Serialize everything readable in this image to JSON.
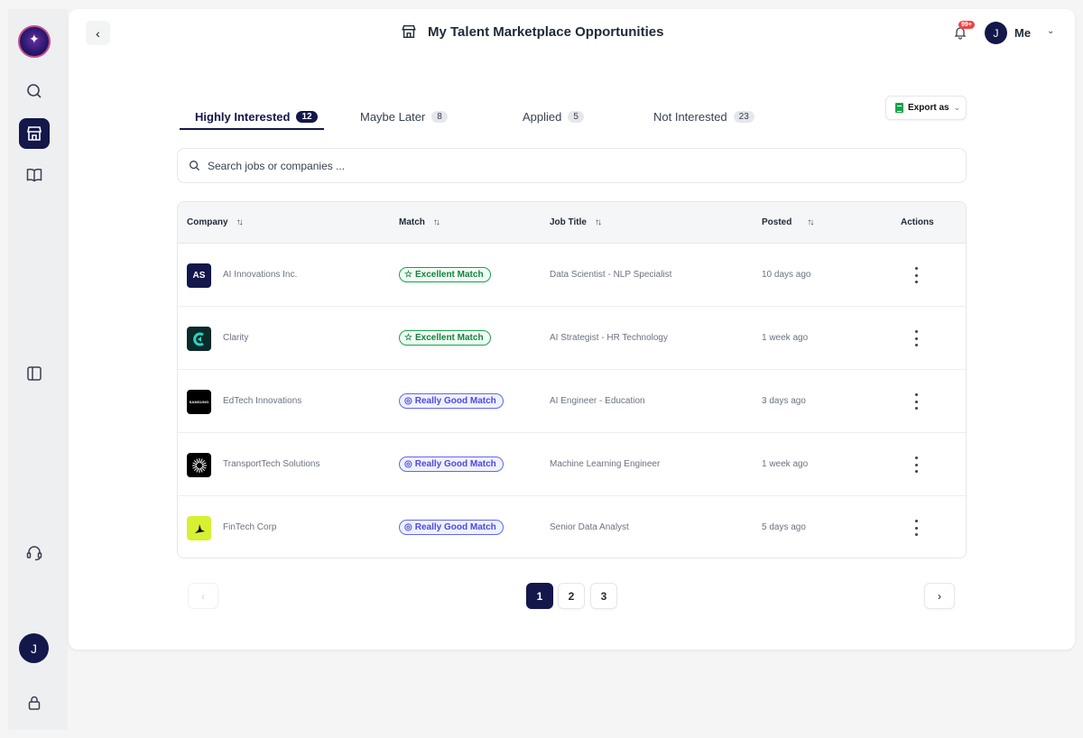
{
  "header": {
    "title": "My Talent Marketplace Opportunities",
    "notification_badge": "99+",
    "user_initial": "J",
    "user_name": "Me"
  },
  "sidebar": {
    "avatar_initial": "J",
    "items": [
      {
        "icon": "search-icon",
        "active": false
      },
      {
        "icon": "store-icon",
        "active": true
      },
      {
        "icon": "book-icon",
        "active": false
      },
      {
        "icon": "panel-icon",
        "active": false
      },
      {
        "icon": "headset-icon",
        "active": false
      },
      {
        "icon": "lock-icon",
        "active": false
      }
    ]
  },
  "tabs": [
    {
      "label": "Highly Interested",
      "count": "12",
      "active": true
    },
    {
      "label": "Maybe Later",
      "count": "8",
      "active": false
    },
    {
      "label": "Applied",
      "count": "5",
      "active": false
    },
    {
      "label": "Not Interested",
      "count": "23",
      "active": false
    }
  ],
  "export": {
    "label": "Export as"
  },
  "search": {
    "placeholder": "Search jobs or companies ..."
  },
  "table": {
    "columns": [
      "Company",
      "Match",
      "Job Title",
      "Posted",
      "Actions"
    ],
    "rows": [
      {
        "logo_text": "AS",
        "logo_color": "#13174a",
        "company": "AI Innovations Inc.",
        "match": "Excellent Match",
        "match_type": "excellent",
        "job_title": "Data Scientist - NLP Specialist",
        "posted": "10 days ago"
      },
      {
        "logo_text": "",
        "logo_color": "#0b2a2a",
        "company": "Clarity",
        "match": "Excellent Match",
        "match_type": "excellent",
        "job_title": "AI Strategist - HR Technology",
        "posted": "1 week ago"
      },
      {
        "logo_text": "SAMSUNG",
        "logo_color": "#000000",
        "company": "EdTech Innovations",
        "match": "Really Good Match",
        "match_type": "good",
        "job_title": "AI Engineer - Education",
        "posted": "3 days ago"
      },
      {
        "logo_text": "",
        "logo_color": "#000000",
        "company": "TransportTech Solutions",
        "match": "Really Good Match",
        "match_type": "good",
        "job_title": "Machine Learning Engineer",
        "posted": "1 week ago"
      },
      {
        "logo_text": "",
        "logo_color": "#d7f032",
        "company": "FinTech Corp",
        "match": "Really Good Match",
        "match_type": "good",
        "job_title": "Senior Data Analyst",
        "posted": "5 days ago"
      }
    ]
  },
  "pagination": {
    "pages": [
      "1",
      "2",
      "3"
    ],
    "current": "1"
  }
}
